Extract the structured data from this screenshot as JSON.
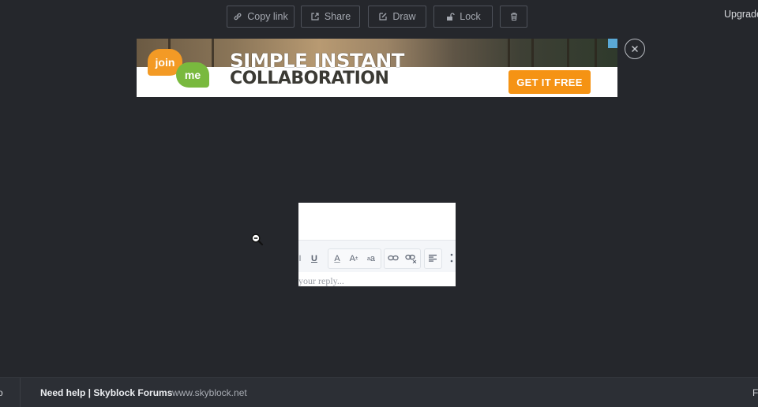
{
  "toolbar": {
    "copy_link": "Copy link",
    "share": "Share",
    "draw": "Draw",
    "lock": "Lock",
    "upgrade": "Upgrade"
  },
  "ad": {
    "logo_join": "join",
    "logo_me": "me",
    "headline_1": "SIMPLE INSTANT",
    "headline_2": "COLLABORATION",
    "cta": "GET IT FREE"
  },
  "image": {
    "format_underline": "U",
    "format_color": "A",
    "format_size": "A",
    "format_size_sup": "±",
    "format_case": "a",
    "format_case_sup": "a",
    "reply_placeholder": "your reply..."
  },
  "footer": {
    "left_fragment": "o",
    "title": "Need help | Skyblock Forums",
    "url": "www.skyblock.net",
    "right_fragment": "F"
  },
  "colors": {
    "background": "#25272c",
    "cta_orange": "#f59314",
    "join_orange": "#f39a25",
    "me_green": "#79b93e"
  }
}
